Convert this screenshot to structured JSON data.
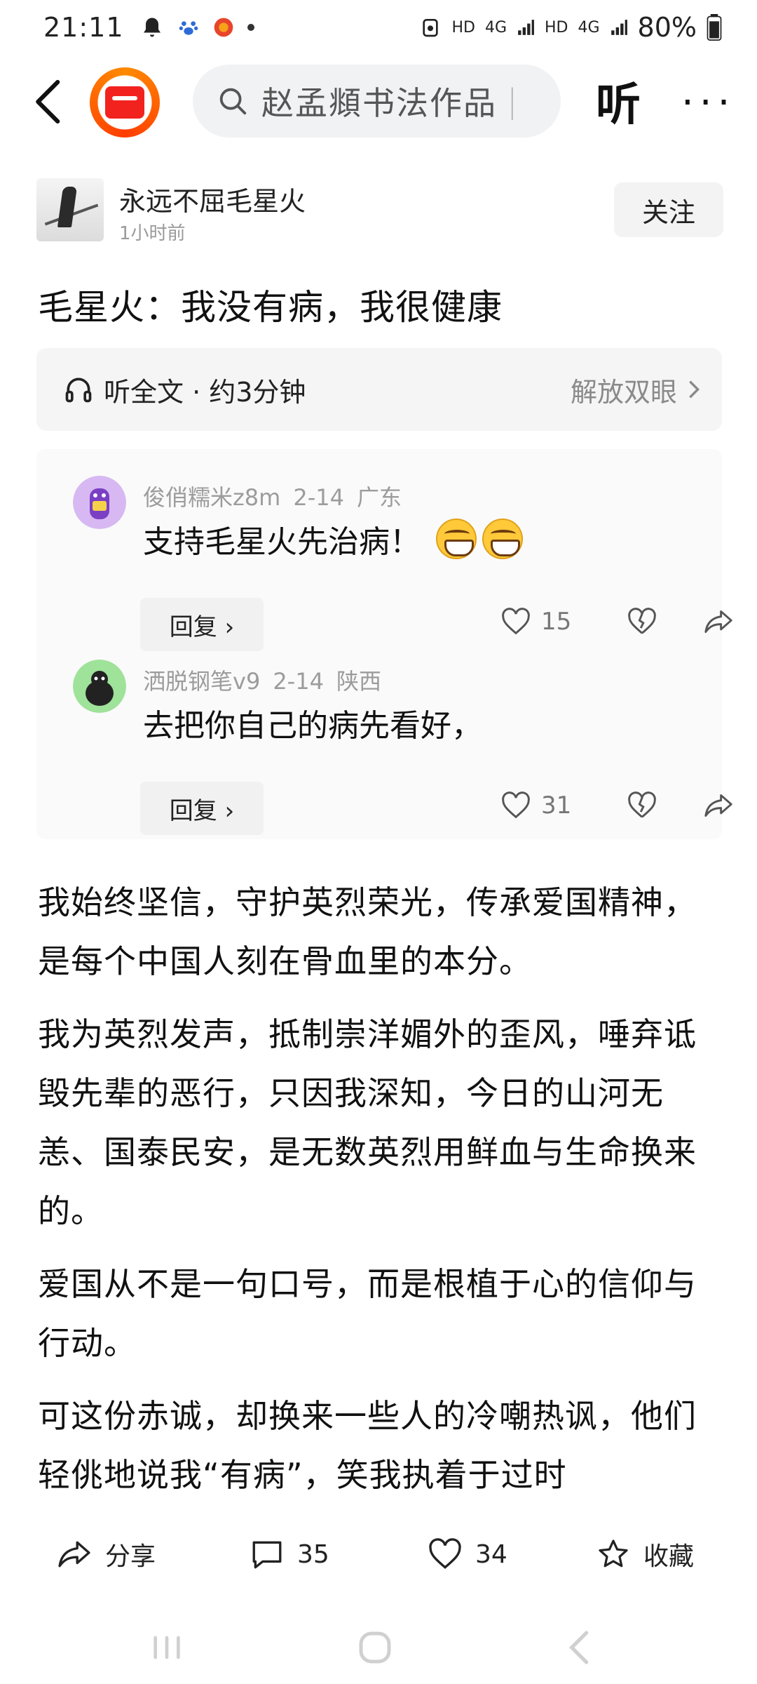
{
  "status_bar": {
    "time": "21:11",
    "network_labels": [
      "HD",
      "4G",
      "HD",
      "4G"
    ],
    "battery": "80%"
  },
  "nav": {
    "search_text": "赵孟頫书法作品",
    "listen_label": "听"
  },
  "author": {
    "name": "永远不屈毛星火",
    "time": "1小时前",
    "follow_label": "关注"
  },
  "article": {
    "title": "毛星火：我没有病，我很健康",
    "audio_label": "听全文 · 约3分钟",
    "audio_action": "解放双眼",
    "paragraphs": [
      "我始终坚信，守护英烈荣光，传承爱国精神，是每个中国人刻在骨血里的本分。",
      "我为英烈发声，抵制崇洋媚外的歪风，唾弃诋毁先辈的恶行，只因我深知，今日的山河无恙、国泰民安，是无数英烈用鲜血与生命换来的。",
      "爱国从不是一句口号，而是根植于心的信仰与行动。",
      "可这份赤诚，却换来一些人的冷嘲热讽，他们轻佻地说我“有病”，笑我执着于过时"
    ]
  },
  "comments": [
    {
      "user": "俊俏糯米z8m",
      "date": "2-14",
      "location": "广东",
      "text": "支持毛星火先治病！",
      "emoji_count": 2,
      "reply_label": "回复 ›",
      "likes": "15"
    },
    {
      "user": "洒脱钢笔v9",
      "date": "2-14",
      "location": "陕西",
      "text": "去把你自己的病先看好，",
      "emoji_count": 0,
      "reply_label": "回复 ›",
      "likes": "31"
    }
  ],
  "bottom_bar": {
    "share_label": "分享",
    "comment_count": "35",
    "like_count": "34",
    "favorite_label": "收藏"
  },
  "colors": {
    "accent_red": "#f2231f",
    "muted_text": "#9c9c9c"
  }
}
